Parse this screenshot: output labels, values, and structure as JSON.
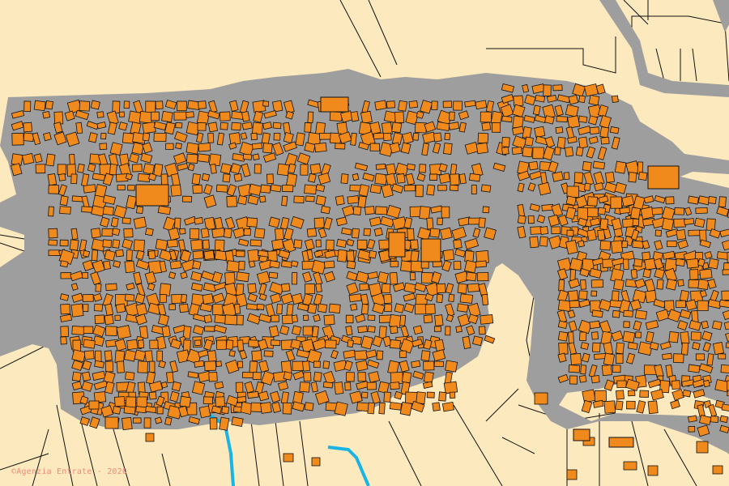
{
  "map": {
    "colors": {
      "background": "#fde9be",
      "road": "#9e9e9e",
      "building_fill": "#f08a1c",
      "building_stroke": "#111111",
      "parcel_line": "#111111",
      "water": "#18b4e6"
    }
  },
  "attribution": {
    "text": "©Agenzia Entrate - 2020"
  }
}
